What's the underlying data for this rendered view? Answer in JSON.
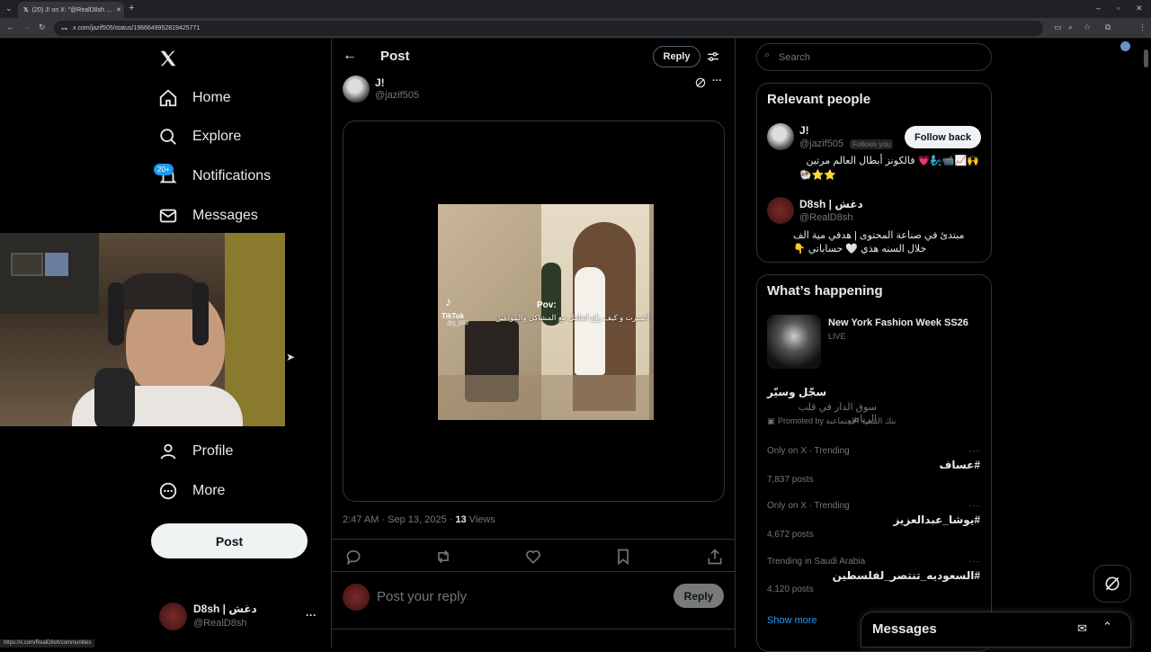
{
  "browser": {
    "tab_title": "(20) J! on X: \"@RealD8sh …",
    "url": "x.com/jazif505/status/1966649952819425771",
    "status_url": "https://x.com/RealD8sh/communities"
  },
  "nav": {
    "home": "Home",
    "explore": "Explore",
    "notifications": "Notifications",
    "notifications_badge": "20+",
    "messages": "Messages",
    "profile": "Profile",
    "more": "More",
    "post_button": "Post",
    "account_name": "D8sh | دغش",
    "account_handle": "@RealD8sh",
    "account_more": "···"
  },
  "post": {
    "header_title": "Post",
    "reply_chip": "Reply",
    "author_name": "J!",
    "author_handle": "@jazif505",
    "more": "···",
    "video_pov": "Pov:",
    "video_caption": "لاتسرت و كيف راح اتعامل مع المشاكل والمواعين",
    "tiktok_label": "TikTok",
    "tiktok_handle": "@g_j552",
    "time": "2:47 AM · Sep 13, 2025 · ",
    "views_count": "13",
    "views_label": " Views",
    "reply_placeholder": "Post your reply",
    "reply_button": "Reply"
  },
  "search": {
    "placeholder": "Search"
  },
  "relevant": {
    "title": "Relevant people",
    "people": [
      {
        "name": "J!",
        "handle": "@jazif505",
        "follows_you": "Follows you",
        "bio_line1": "🙌📈📹🧞‍♂️💗 فالكونز أبطال العالم مرتين",
        "bio_line2": "⭐⭐🐏"
      },
      {
        "name": "D8sh | دغش",
        "handle": "@RealD8sh",
        "bio_line1": "مبتدئ في صناعة المحتوى | هدفي مية الف",
        "bio_line2": "خلال السنه هذي 🤍 حساباتي 👇"
      }
    ],
    "follow_back": "Follow back"
  },
  "happening": {
    "title": "What’s happening",
    "event_title": "New York Fashion Week SS26",
    "event_status": "LIVE",
    "promo_title": "سجّل وسيّر",
    "promo_sub": "سوق الدار في قلب الرياض",
    "promo_by": "Promoted by بنك التنمية الاجتماعية",
    "trends": [
      {
        "meta": "Only on X · Trending",
        "name": "#عساف",
        "count": "7,837 posts"
      },
      {
        "meta": "Only on X · Trending",
        "name": "#يوشا_عبدالعزيز",
        "count": "4,672 posts"
      },
      {
        "meta": "Trending in Saudi Arabia",
        "name": "#السعوديه_تنتصر_لفلسطين",
        "count": "4,120 posts"
      }
    ],
    "show_more": "Show more"
  },
  "messages_drawer": {
    "title": "Messages"
  },
  "colors": {
    "background": "#000000",
    "text": "#e7e9ea",
    "muted": "#71767b",
    "border": "#2f3336",
    "accent": "#1d9bf0"
  }
}
